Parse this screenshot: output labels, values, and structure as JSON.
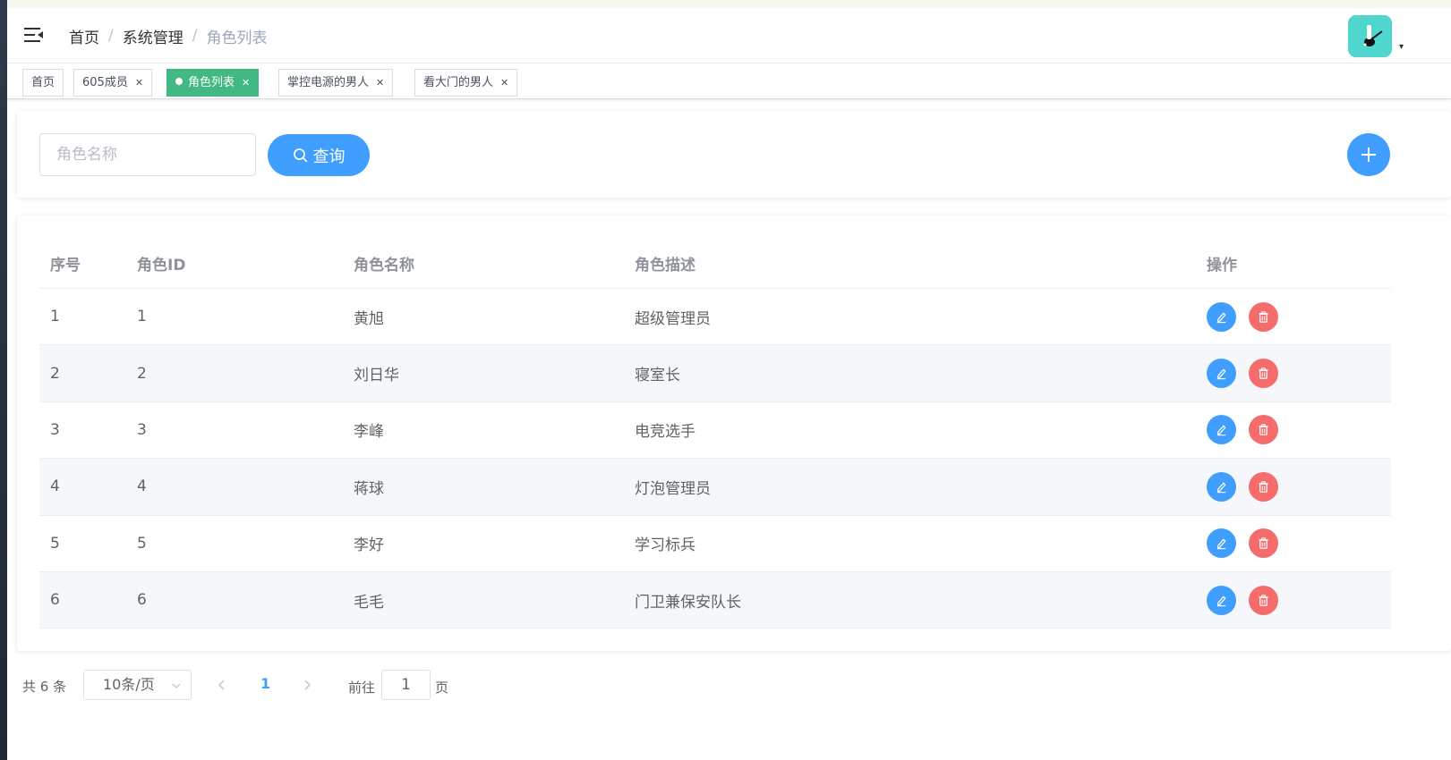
{
  "colors": {
    "primary": "#409eff",
    "danger": "#f56c6c",
    "active_tag": "#42b983",
    "avatar_bg": "#4fd6ce"
  },
  "header": {
    "menu_icon": "hamburger-fold-icon",
    "breadcrumb": [
      "首页",
      "系统管理",
      "角色列表"
    ],
    "avatar_caret": "▾"
  },
  "tags": [
    {
      "label": "首页",
      "closable": false,
      "active": false
    },
    {
      "label": "605成员",
      "closable": true,
      "active": false
    },
    {
      "label": "角色列表",
      "closable": true,
      "active": true
    },
    {
      "label": "掌控电源的男人",
      "closable": true,
      "active": false
    },
    {
      "label": "看大门的男人",
      "closable": true,
      "active": false
    }
  ],
  "search": {
    "placeholder": "角色名称",
    "value": "",
    "button_label": "查询",
    "add_icon": "plus-icon"
  },
  "table": {
    "columns": [
      "序号",
      "角色ID",
      "角色名称",
      "角色描述",
      "操作"
    ],
    "rows": [
      {
        "index": "1",
        "id": "1",
        "name": "黄旭",
        "desc": "超级管理员"
      },
      {
        "index": "2",
        "id": "2",
        "name": "刘日华",
        "desc": "寝室长"
      },
      {
        "index": "3",
        "id": "3",
        "name": "李峰",
        "desc": "电竞选手"
      },
      {
        "index": "4",
        "id": "4",
        "name": "蒋球",
        "desc": "灯泡管理员"
      },
      {
        "index": "5",
        "id": "5",
        "name": "李好",
        "desc": "学习标兵"
      },
      {
        "index": "6",
        "id": "6",
        "name": "毛毛",
        "desc": "门卫兼保安队长"
      }
    ],
    "row_actions": [
      "edit-icon",
      "delete-icon"
    ]
  },
  "pagination": {
    "total_text": "共 6 条",
    "page_size": "10条/页",
    "current_page": "1",
    "goto_label": "前往",
    "goto_value": "1",
    "goto_suffix": "页"
  }
}
